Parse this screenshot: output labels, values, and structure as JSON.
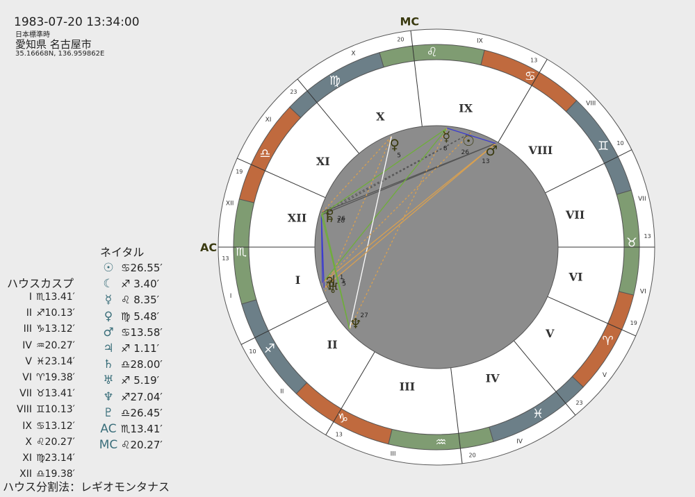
{
  "header": {
    "datetime": "1983-07-20 13:34:00",
    "timezone": "日本標準時",
    "place": "愛知県 名古屋市",
    "coords": "35.16668N, 136.959862E"
  },
  "natal": {
    "title": "ネイタル",
    "rows": [
      {
        "glyph": "☉",
        "value": "♋26.55′"
      },
      {
        "glyph": "☾",
        "value": "♐ 3.40′"
      },
      {
        "glyph": "☿",
        "value": "♌ 8.35′"
      },
      {
        "glyph": "♀",
        "value": "♍ 5.48′"
      },
      {
        "glyph": "♂",
        "value": "♋13.58′"
      },
      {
        "glyph": "♃",
        "value": "♐ 1.11′"
      },
      {
        "glyph": "♄",
        "value": "♎28.00′"
      },
      {
        "glyph": "♅",
        "value": "♐ 5.19′"
      },
      {
        "glyph": "♆",
        "value": "♐27.04′"
      },
      {
        "glyph": "♇",
        "value": "♎26.45′"
      },
      {
        "glyph": "AC",
        "value": "♏13.41′"
      },
      {
        "glyph": "MC",
        "value": "♌20.27′"
      }
    ]
  },
  "cusps": {
    "title": "ハウスカスプ",
    "rows": [
      {
        "house": "I",
        "value": "♏13.41′"
      },
      {
        "house": "II",
        "value": "♐10.13′"
      },
      {
        "house": "III",
        "value": "♑13.12′"
      },
      {
        "house": "IV",
        "value": "♒20.27′"
      },
      {
        "house": "V",
        "value": "♓23.14′"
      },
      {
        "house": "VI",
        "value": "♈19.38′"
      },
      {
        "house": "VII",
        "value": "♉13.41′"
      },
      {
        "house": "VIII",
        "value": "♊10.13′"
      },
      {
        "house": "IX",
        "value": "♋13.12′"
      },
      {
        "house": "X",
        "value": "♌20.27′"
      },
      {
        "house": "XI",
        "value": "♍23.14′"
      },
      {
        "house": "XII",
        "value": "♎19.38′"
      }
    ]
  },
  "footer": "ハウス分割法：レギオモンタナス",
  "wheel": {
    "signs": [
      "♈",
      "♉",
      "♊",
      "♋",
      "♌",
      "♍",
      "♎",
      "♏",
      "♐",
      "♑",
      "♒",
      "♓"
    ],
    "sign_colors": [
      "#c06a3e",
      "#7f9c72",
      "#6c7f88",
      "#c06a3e",
      "#7f9c72",
      "#6c7f88",
      "#c06a3e",
      "#7f9c72",
      "#6c7f88",
      "#c06a3e",
      "#7f9c72",
      "#6c7f88"
    ],
    "asc_longitude": 223.68,
    "house_labels": [
      "I",
      "II",
      "III",
      "IV",
      "V",
      "VI",
      "VII",
      "VIII",
      "IX",
      "X",
      "XI",
      "XII"
    ],
    "house_cusps": [
      223.68,
      250.22,
      283.2,
      320.45,
      353.23,
      19.63,
      43.68,
      70.22,
      103.2,
      140.45,
      173.23,
      199.63
    ],
    "house_outer_labels": [
      "I",
      "II",
      "III",
      "IV",
      "V",
      "VI",
      "VII",
      "VIII",
      "IX",
      "X",
      "XI",
      "XII"
    ],
    "cusp_degree_labels": [
      "13",
      "10",
      "13",
      "20",
      "23",
      "19",
      "13",
      "10",
      "13",
      "20",
      "23",
      "19"
    ],
    "angle_labels": {
      "asc": "AC",
      "mc": "MC"
    },
    "planets": [
      {
        "glyph": "☉",
        "lon": 116.92,
        "label": "26"
      },
      {
        "glyph": "☾",
        "lon": 243.67,
        "label": "3"
      },
      {
        "glyph": "☿",
        "lon": 128.58,
        "label": "8"
      },
      {
        "glyph": "♀",
        "lon": 155.8,
        "label": "5"
      },
      {
        "glyph": "♂",
        "lon": 103.97,
        "label": "13"
      },
      {
        "glyph": "♃",
        "lon": 241.18,
        "label": "1"
      },
      {
        "glyph": "♄",
        "lon": 208.0,
        "label": "28"
      },
      {
        "glyph": "♅",
        "lon": 245.32,
        "label": "5"
      },
      {
        "glyph": "♆",
        "lon": 267.07,
        "label": "27"
      },
      {
        "glyph": "♇",
        "lon": 206.75,
        "label": "26"
      }
    ],
    "aspects": [
      {
        "a": "♂",
        "b": "♇",
        "color": "#555555",
        "dash": false
      },
      {
        "a": "♂",
        "b": "♄",
        "color": "#555555",
        "dash": false
      },
      {
        "a": "☉",
        "b": "♇",
        "color": "#555555",
        "dash": true
      },
      {
        "a": "☉",
        "b": "♄",
        "color": "#555555",
        "dash": true
      },
      {
        "a": "☿",
        "b": "♄",
        "color": "#6fae3a",
        "dash": false
      },
      {
        "a": "☿",
        "b": "♃",
        "color": "#6fae3a",
        "dash": false
      },
      {
        "a": "☿",
        "b": "♆",
        "color": "#d9a050",
        "dash": true
      },
      {
        "a": "♀",
        "b": "♇",
        "color": "#d9a050",
        "dash": true
      },
      {
        "a": "♀",
        "b": "♅",
        "color": "#d9a050",
        "dash": true
      },
      {
        "a": "♀",
        "b": "♆",
        "color": "#ffffff",
        "dash": false
      },
      {
        "a": "♂",
        "b": "☾",
        "color": "#d9a050",
        "dash": false
      },
      {
        "a": "♂",
        "b": "♃",
        "color": "#d9a050",
        "dash": false
      },
      {
        "a": "☉",
        "b": "♃",
        "color": "#d9a050",
        "dash": true
      },
      {
        "a": "☿",
        "b": "♂",
        "color": "#3b3bd0",
        "dash": false
      },
      {
        "a": "♄",
        "b": "♃",
        "color": "#3b3bd0",
        "dash": false
      },
      {
        "a": "♄",
        "b": "☾",
        "color": "#3b3bd0",
        "dash": false
      },
      {
        "a": "♇",
        "b": "♆",
        "color": "#6fae3a",
        "dash": false
      },
      {
        "a": "♄",
        "b": "♆",
        "color": "#6fae3a",
        "dash": false
      }
    ]
  }
}
